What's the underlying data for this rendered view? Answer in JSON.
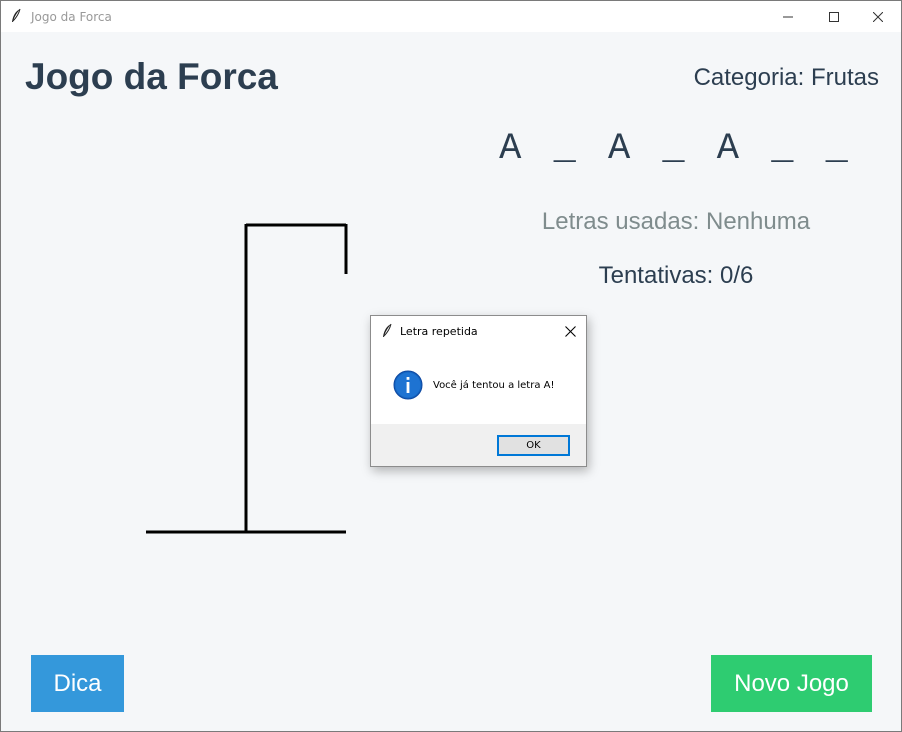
{
  "window": {
    "title": "Jogo da Forca"
  },
  "header": {
    "title": "Jogo da Forca",
    "category": "Categoria: Frutas"
  },
  "game": {
    "word_display": "A _ A _ A _ _",
    "used_letters": "Letras usadas: Nenhuma",
    "attempts": "Tentativas: 0/6"
  },
  "buttons": {
    "hint_label": "Dica",
    "new_game_label": "Novo Jogo"
  },
  "dialog": {
    "title": "Letra repetida",
    "message": "Você já tentou a letra A!",
    "ok_label": "OK",
    "icon": "info-icon"
  },
  "colors": {
    "hint_button": "#3498db",
    "new_game_button": "#2ecc71",
    "title_text": "#2c3e50",
    "used_letters_text": "#7f8c8d",
    "background": "#f5f7f9"
  }
}
